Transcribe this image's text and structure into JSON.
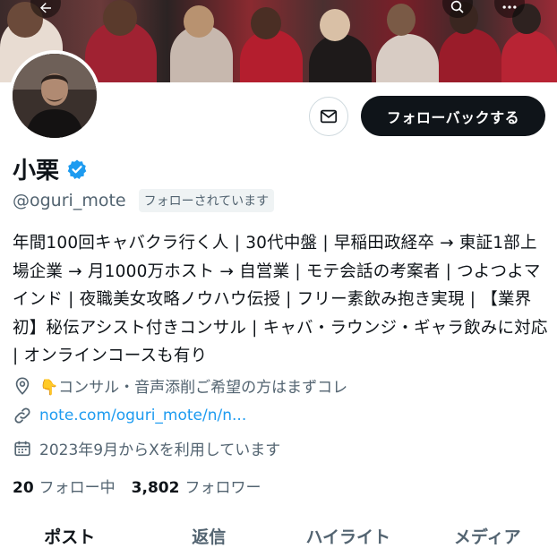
{
  "profile": {
    "name": "小栗",
    "handle": "@oguri_mote",
    "follows_you_badge": "フォローされています",
    "bio": "年間100回キャバクラ行く人 | 30代中盤 | 早稲田政経卒 → 東証1部上場企業 → 月1000万ホスト → 自営業 | モテ会話の考案者 | つよつよマインド | 夜職美女攻略ノウハウ伝授 | フリー素飲み抱き実現 | 【業界初】秘伝アシスト付きコンサル | キャバ・ラウンジ・ギャラ飲みに対応 | オンラインコースも有り",
    "location": "👇コンサル・音声添削ご希望の方はまずコレ",
    "link": "note.com/oguri_mote/n/n...",
    "joined": "2023年9月からXを利用しています"
  },
  "actions": {
    "follow_back_label": "フォローバックする"
  },
  "stats": {
    "following_count": "20",
    "following_label": "フォロー中",
    "followers_count": "3,802",
    "followers_label": "フォロワー"
  },
  "tabs": [
    {
      "label": "ポスト",
      "active": true
    },
    {
      "label": "返信",
      "active": false
    },
    {
      "label": "ハイライト",
      "active": false
    },
    {
      "label": "メディア",
      "active": false
    }
  ],
  "icons": {
    "back": "arrow-left-icon",
    "search": "search-icon",
    "more": "more-dots-icon",
    "message": "envelope-icon",
    "verified": "verified-badge-icon",
    "location": "location-pin-icon",
    "link": "link-icon",
    "calendar": "calendar-icon"
  },
  "colors": {
    "accent": "#1d9bf0",
    "primary_button": "#0f1419",
    "secondary_text": "#536471"
  }
}
